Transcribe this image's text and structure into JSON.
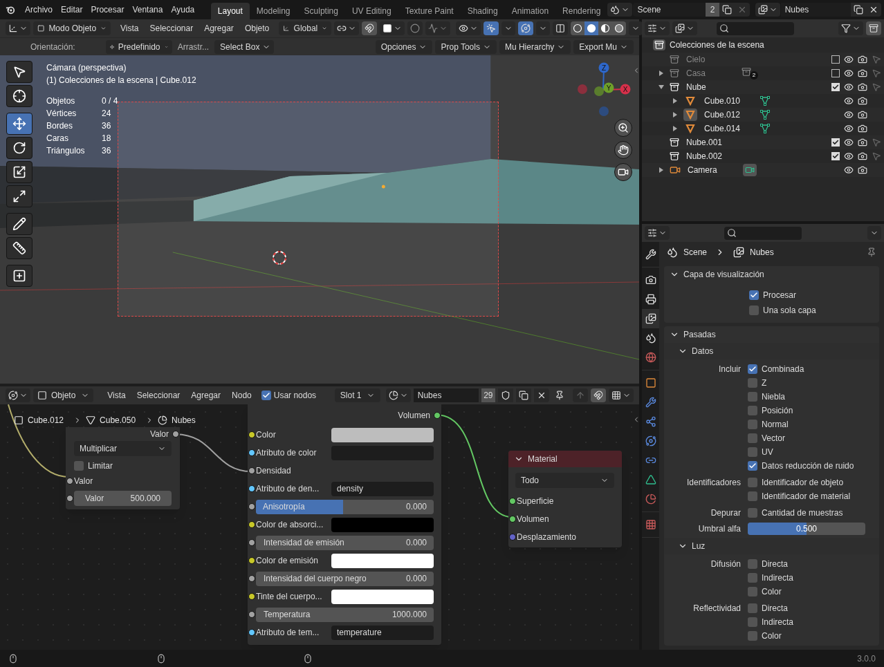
{
  "topbar": {
    "menus": [
      "Archivo",
      "Editar",
      "Procesar",
      "Ventana",
      "Ayuda"
    ],
    "workspaces": [
      {
        "label": "Layout",
        "selected": true
      },
      {
        "label": "Modeling",
        "selected": false
      },
      {
        "label": "Sculpting",
        "selected": false
      },
      {
        "label": "UV Editing",
        "selected": false
      },
      {
        "label": "Texture Paint",
        "selected": false
      },
      {
        "label": "Shading",
        "selected": false
      },
      {
        "label": "Animation",
        "selected": false
      },
      {
        "label": "Rendering",
        "selected": false
      }
    ],
    "scene": {
      "name": "Scene",
      "users": "2"
    },
    "view_layer": {
      "name": "Nubes"
    }
  },
  "viewport": {
    "mode": "Modo Objeto",
    "menus": [
      "Vista",
      "Seleccionar",
      "Agregar",
      "Objeto"
    ],
    "orientation": "Global",
    "shading": [
      {
        "kind": "wireframe",
        "selected": false
      },
      {
        "kind": "solid",
        "selected": true
      },
      {
        "kind": "material",
        "selected": false
      },
      {
        "kind": "rendered",
        "selected": false
      }
    ],
    "tool_settings": {
      "orientation_label": "Orientación:",
      "orientation": "Predefinido",
      "drag_label": "Arrastr...",
      "drag": "Select Box"
    },
    "addon_menus": [
      "Opciones",
      "Prop Tools",
      "Mu Hierarchy",
      "Export Mu"
    ],
    "overlay": {
      "title": "Cámara (perspectiva)",
      "context": "(1) Colecciones de la escena | Cube.012",
      "stats": [
        {
          "label": "Objetos",
          "value": "0 / 4"
        },
        {
          "label": "Vértices",
          "value": "24"
        },
        {
          "label": "Bordes",
          "value": "36"
        },
        {
          "label": "Caras",
          "value": "18"
        },
        {
          "label": "Triángulos",
          "value": "36"
        }
      ]
    },
    "tools": [
      [
        {
          "kind": "select",
          "selected": false
        },
        {
          "kind": "cursor",
          "selected": false
        }
      ],
      [
        {
          "kind": "move",
          "selected": true
        },
        {
          "kind": "rotate",
          "selected": false
        },
        {
          "kind": "scale",
          "selected": false
        },
        {
          "kind": "transform",
          "selected": false
        }
      ],
      [
        {
          "kind": "annotate",
          "selected": false
        },
        {
          "kind": "measure",
          "selected": false
        }
      ],
      [
        {
          "kind": "add",
          "selected": false
        }
      ]
    ],
    "gizmo": {
      "x": "X",
      "y": "Y",
      "z": "Z"
    }
  },
  "node_editor": {
    "object": "Objeto",
    "menus": [
      "Vista",
      "Seleccionar",
      "Agregar",
      "Nodo"
    ],
    "use_nodes": {
      "label": "Usar nodos",
      "checked": true
    },
    "slot": "Slot 1",
    "material": {
      "name": "Nubes",
      "users": "29"
    },
    "breadcrumbs": [
      "Cube.012",
      "Cube.050",
      "Nubes"
    ],
    "math_node": {
      "output": "Valor",
      "operation": "Multiplicar",
      "clamp": {
        "label": "Limitar",
        "checked": false
      },
      "input": "Valor",
      "field": {
        "label": "Valor",
        "value": "500.000"
      }
    },
    "volume_node": {
      "output": "Volumen",
      "inputs": [
        {
          "kind": "color",
          "label": "Color",
          "color": "#bdbdbd"
        },
        {
          "kind": "attr",
          "label": "Atributo de color"
        },
        {
          "kind": "socket",
          "label": "Densidad"
        },
        {
          "kind": "attr",
          "label": "Atributo de den...",
          "value": "density"
        },
        {
          "kind": "slider",
          "label": "Anisotropía",
          "value": "0.000",
          "level": 0.49
        },
        {
          "kind": "color",
          "label": "Color de absorci...",
          "color": "#000000"
        },
        {
          "kind": "field",
          "label": "Intensidad de emisión",
          "value": "0.000"
        },
        {
          "kind": "color",
          "label": "Color de emisión",
          "color": "#ffffff"
        },
        {
          "kind": "field",
          "label": "Intensidad del cuerpo negro",
          "value": "0.000"
        },
        {
          "kind": "color",
          "label": "Tinte del cuerpo...",
          "color": "#ffffff"
        },
        {
          "kind": "field",
          "label": "Temperatura",
          "value": "1000.000"
        },
        {
          "kind": "attr",
          "label": "Atributo de tem...",
          "value": "temperature"
        }
      ]
    },
    "output_node": {
      "title": "Material",
      "target": "Todo",
      "inputs": [
        {
          "label": "Superficie",
          "color": "#63c763"
        },
        {
          "label": "Volumen",
          "color": "#63c763"
        },
        {
          "label": "Desplazamiento",
          "color": "#6363c7"
        }
      ]
    }
  },
  "outliner": {
    "root": "Colecciones de la escena",
    "items": [
      {
        "name": "Cielo",
        "kind": "collection",
        "checked": false
      },
      {
        "name": "Casa",
        "kind": "collection",
        "checked": false,
        "expanded": false,
        "badge": "2"
      },
      {
        "name": "Nube",
        "kind": "collection",
        "checked": true,
        "expanded": true,
        "children": [
          {
            "name": "Cube.010",
            "kind": "mesh",
            "expanded": false,
            "active": false
          },
          {
            "name": "Cube.012",
            "kind": "mesh",
            "expanded": false,
            "active": true
          },
          {
            "name": "Cube.014",
            "kind": "mesh",
            "expanded": false,
            "active": false
          }
        ]
      },
      {
        "name": "Nube.001",
        "kind": "collection",
        "checked": true
      },
      {
        "name": "Nube.002",
        "kind": "collection",
        "checked": true
      },
      {
        "name": "Camera",
        "kind": "camera",
        "expanded": false
      }
    ]
  },
  "properties": {
    "tabs": [
      [
        {
          "kind": "tool",
          "selected": false
        }
      ],
      [
        {
          "kind": "render",
          "selected": false
        },
        {
          "kind": "output",
          "selected": false
        },
        {
          "kind": "view_layer",
          "selected": true
        },
        {
          "kind": "scene",
          "selected": false
        },
        {
          "kind": "world",
          "selected": false
        }
      ],
      [
        {
          "kind": "object",
          "selected": false
        },
        {
          "kind": "modifiers",
          "selected": false
        },
        {
          "kind": "particles",
          "selected": false
        },
        {
          "kind": "physics",
          "selected": false
        },
        {
          "kind": "constraints",
          "selected": false
        },
        {
          "kind": "data",
          "selected": false
        },
        {
          "kind": "material",
          "selected": false
        }
      ],
      [
        {
          "kind": "texture",
          "selected": false
        }
      ]
    ],
    "breadcrumb": [
      "Scene",
      "Nubes"
    ],
    "panels": [
      {
        "kind": "options",
        "title": "Capa de visualización",
        "expanded": true,
        "options": [
          {
            "label": "Procesar",
            "checked": true
          },
          {
            "label": "Una sola capa",
            "checked": false
          }
        ]
      },
      {
        "kind": "passes",
        "title": "Pasadas",
        "expanded": true,
        "subpanels": [
          {
            "title": "Datos",
            "expanded": true,
            "groups": [
              {
                "label": "Incluir",
                "options": [
                  {
                    "label": "Combinada",
                    "checked": true
                  },
                  {
                    "label": "Z",
                    "checked": false
                  },
                  {
                    "label": "Niebla",
                    "checked": false
                  },
                  {
                    "label": "Posición",
                    "checked": false
                  },
                  {
                    "label": "Normal",
                    "checked": false
                  },
                  {
                    "label": "Vector",
                    "checked": false
                  },
                  {
                    "label": "UV",
                    "checked": false
                  },
                  {
                    "label": "Datos reducción de ruido",
                    "checked": true
                  }
                ]
              },
              {
                "label": "Identificadores",
                "options": [
                  {
                    "label": "Identificador de objeto",
                    "checked": false
                  },
                  {
                    "label": "Identificador de material",
                    "checked": false
                  }
                ]
              },
              {
                "label": "Depurar",
                "options": [
                  {
                    "label": "Cantidad de muestras",
                    "checked": false
                  }
                ]
              }
            ],
            "slider": {
              "label": "Umbral alfa",
              "value": "0.500",
              "level": 0.5
            }
          },
          {
            "title": "Luz",
            "expanded": true,
            "groups": [
              {
                "label": "Difusión",
                "options": [
                  {
                    "label": "Directa",
                    "checked": false
                  },
                  {
                    "label": "Indirecta",
                    "checked": false
                  },
                  {
                    "label": "Color",
                    "checked": false
                  }
                ]
              },
              {
                "label": "Reflectividad",
                "options": [
                  {
                    "label": "Directa",
                    "checked": false
                  },
                  {
                    "label": "Indirecta",
                    "checked": false
                  },
                  {
                    "label": "Color",
                    "checked": false
                  }
                ]
              }
            ]
          }
        ]
      }
    ]
  },
  "status_bar": {
    "version": "3.0.0"
  }
}
